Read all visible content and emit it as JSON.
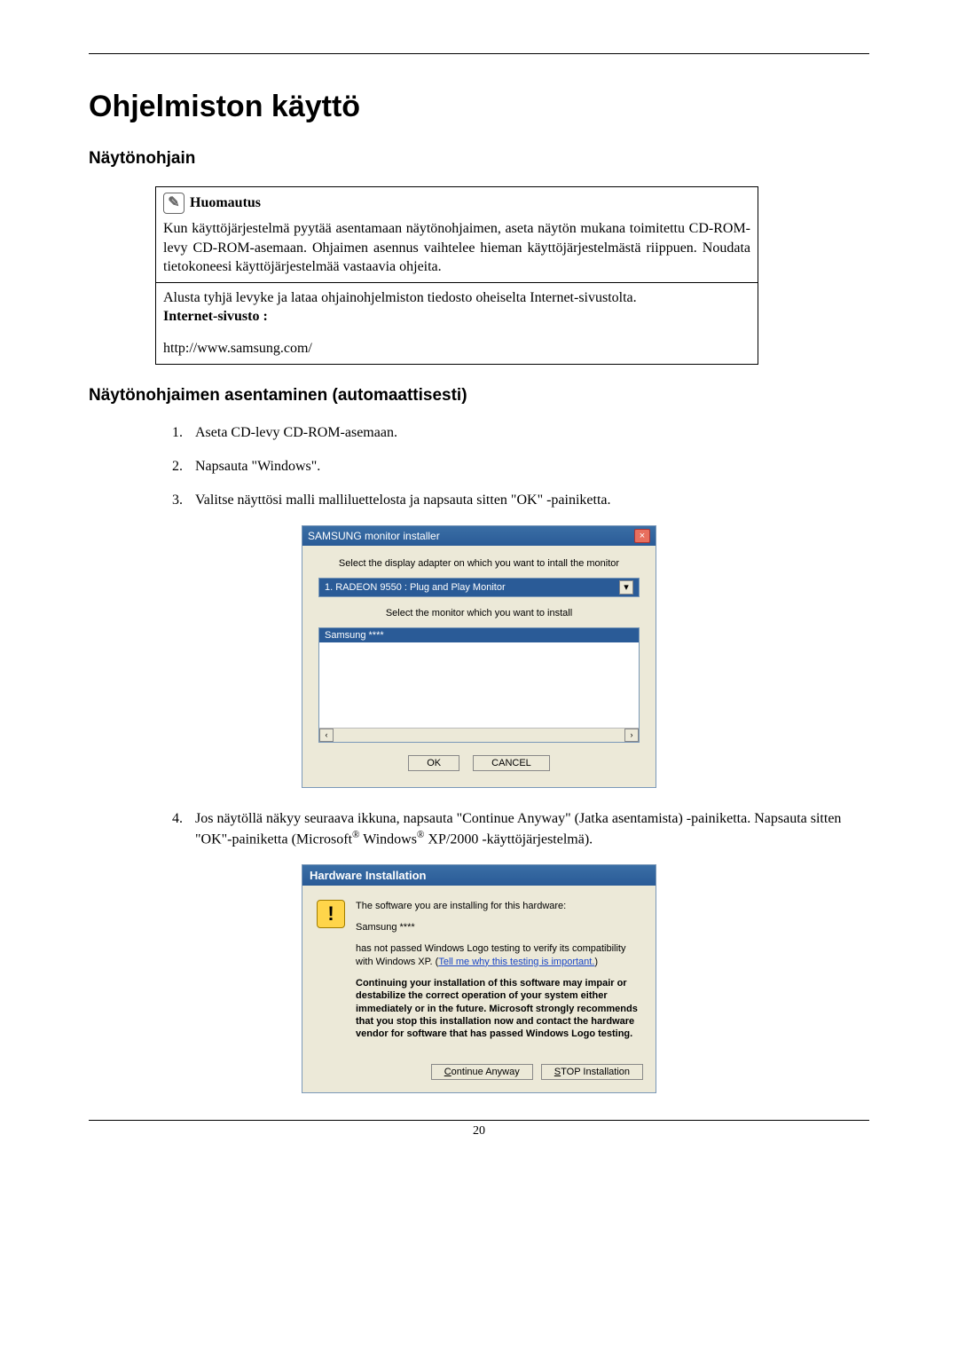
{
  "page": {
    "title": "Ohjelmiston käyttö",
    "number": "20"
  },
  "section1": {
    "heading": "Näytönohjain",
    "note": {
      "label": "Huomautus",
      "body": "Kun käyttöjärjestelmä pyytää asentamaan näytönohjaimen, aseta näytön mukana toimitettu CD-ROM-levy CD-ROM-asemaan. Ohjaimen asennus vaihtelee hieman käyttöjärjestelmästä riippuen. Noudata tietokoneesi käyttöjärjestelmää vastaavia ohjeita.",
      "prep": "Alusta tyhjä levyke ja lataa ohjainohjelmiston tiedosto oheiselta Internet-sivustolta.",
      "site_label": "Internet-sivusto :",
      "url": "http://www.samsung.com/"
    }
  },
  "section2": {
    "heading": "Näytönohjaimen asentaminen (automaattisesti)",
    "steps": {
      "1": "Aseta CD-levy CD-ROM-asemaan.",
      "2": "Napsauta \"Windows\".",
      "3": "Valitse näyttösi malli malliluettelosta ja napsauta sitten \"OK\" -painiketta.",
      "4a": "Jos näytöllä näkyy seuraava ikkuna, napsauta \"Continue Anyway\" (Jatka asentamista) -painiketta. Napsauta sitten \"OK\"-painiketta (Microsoft",
      "4b": " Windows",
      "4c": " XP/2000 -käyttöjärjestelmä).",
      "reg": "®"
    }
  },
  "installer": {
    "title": "SAMSUNG monitor installer",
    "label1": "Select the display adapter on which you want to intall the monitor",
    "adapter": "1. RADEON 9550 : Plug and Play Monitor",
    "label2": "Select the monitor which you want to install",
    "item": "Samsung ****",
    "ok": "OK",
    "cancel": "CANCEL"
  },
  "hw": {
    "title": "Hardware Installation",
    "line1": "The software you are installing for this hardware:",
    "line2": "Samsung ****",
    "line3a": "has not passed Windows Logo testing to verify its compatibility with Windows XP. (",
    "link": "Tell me why this testing is important.",
    "line3b": ")",
    "warn": "Continuing your installation of this software may impair or destabilize the correct operation of your system either immediately or in the future. Microsoft strongly recommends that you stop this installation now and contact the hardware vendor for software that has passed Windows Logo testing.",
    "btn_continue_u": "C",
    "btn_continue_rest": "ontinue Anyway",
    "btn_stop_u": "S",
    "btn_stop_rest": "TOP Installation"
  }
}
